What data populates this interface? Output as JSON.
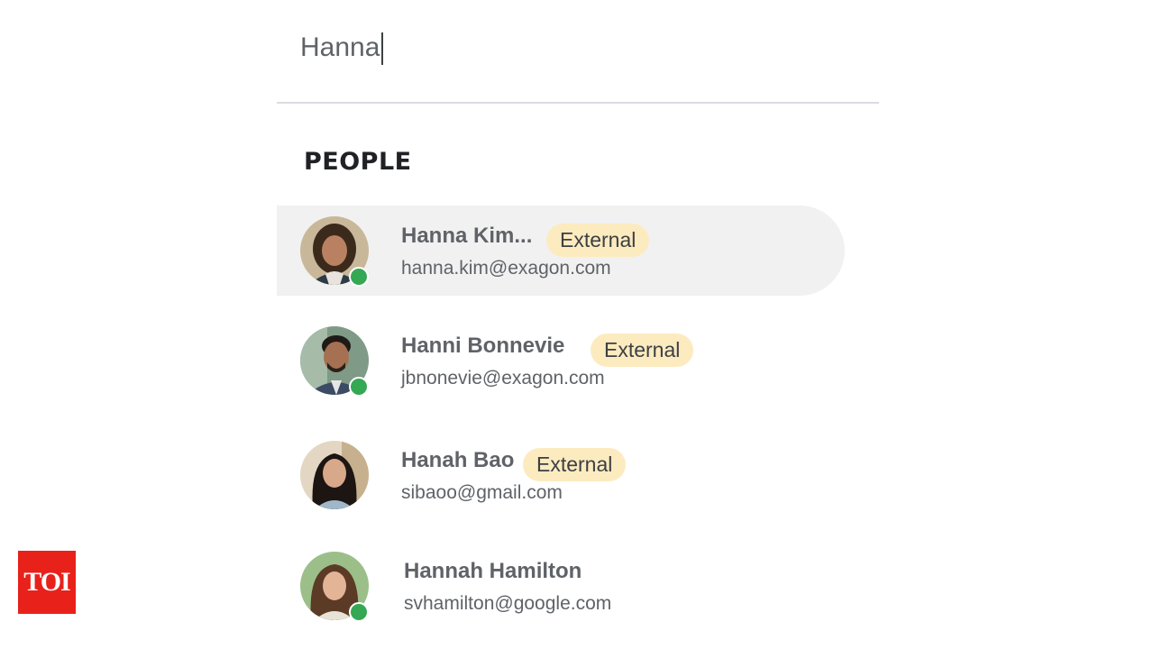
{
  "search": {
    "value": "Hanna",
    "placeholder": ""
  },
  "people_section": {
    "heading": "PEOPLE"
  },
  "people": [
    {
      "name": "Hanna Kim...",
      "email": "hanna.kim@exagon.com",
      "badge": "External",
      "status": "online",
      "selected": true
    },
    {
      "name": "Hanni Bonnevie",
      "email": "jbnonevie@exagon.com",
      "badge": "External",
      "status": "online",
      "selected": false
    },
    {
      "name": "Hanah Bao",
      "email": "sibaoo@gmail.com",
      "badge": "External",
      "status": "none",
      "selected": false
    },
    {
      "name": "Hannah Hamilton",
      "email": "svhamilton@google.com",
      "badge": "",
      "status": "online",
      "selected": false
    }
  ],
  "colors": {
    "selected_row": "#f1f1f1",
    "badge_bg": "#fdebc0",
    "online": "#34a853",
    "logo_bg": "#e8211b"
  },
  "logo": {
    "text": "TOI"
  }
}
